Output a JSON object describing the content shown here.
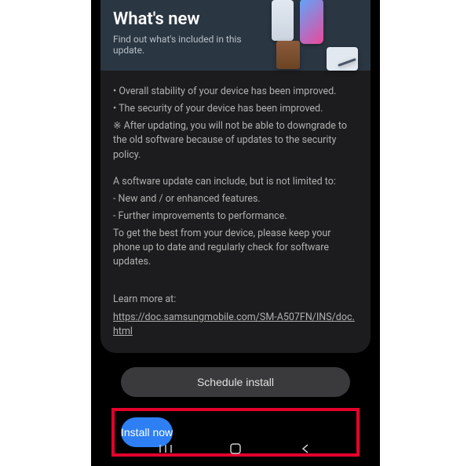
{
  "header": {
    "title": "What's new",
    "subtitle": "Find out what's included in this update."
  },
  "body": {
    "bullet1": "• Overall stability of your device has been improved.",
    "bullet2": "• The security of your device has been improved.",
    "note": "※ After updating, you will not be able to downgrade to the old software because of updates to the security policy.",
    "para2_intro": "A software update can include, but is not limited to:",
    "para2_item1": " - New and / or enhanced features.",
    "para2_item2": " - Further improvements to performance.",
    "para2_outro": "To get the best from your device, please keep your phone up to date and regularly check for software updates.",
    "learn_label": "Learn more at:",
    "learn_url": "https://doc.samsungmobile.com/SM-A507FN/INS/doc.html"
  },
  "buttons": {
    "schedule": "Schedule install",
    "install": "Install now"
  }
}
